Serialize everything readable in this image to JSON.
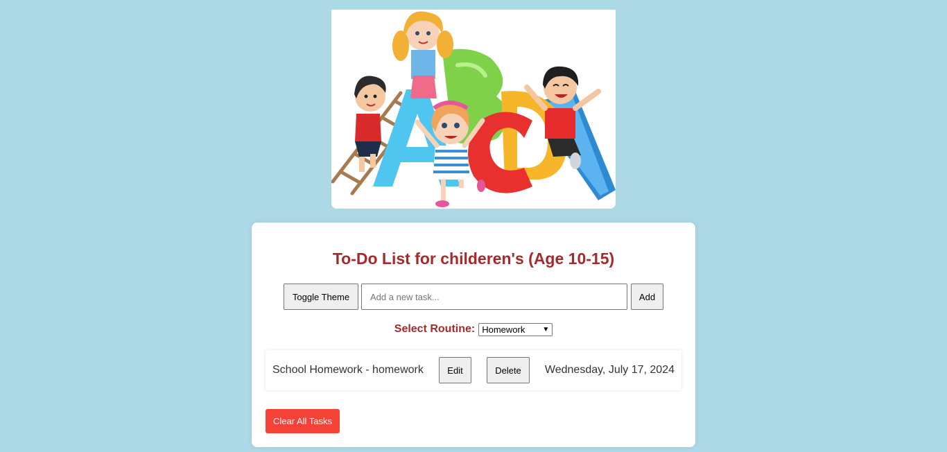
{
  "hero": {
    "alt": "Cartoon children playing with colorful ABC letters, a ladder and a slide"
  },
  "todo": {
    "title": "To-Do List for childeren's (Age 10-15)",
    "toggle_theme_label": "Toggle Theme",
    "task_input": {
      "placeholder": "Add a new task...",
      "value": ""
    },
    "add_label": "Add",
    "routine": {
      "label": "Select Routine:",
      "selected": "Homework"
    },
    "tasks": [
      {
        "text": "School Homework - homework",
        "edit_label": "Edit",
        "delete_label": "Delete",
        "date": "Wednesday, July 17, 2024"
      }
    ],
    "clear_all_label": "Clear All Tasks"
  },
  "colors": {
    "page_background": "#add8e6",
    "title": "#a52a2a",
    "clear_button": "#f44336"
  },
  "icons": [
    "chevron-down-icon"
  ]
}
